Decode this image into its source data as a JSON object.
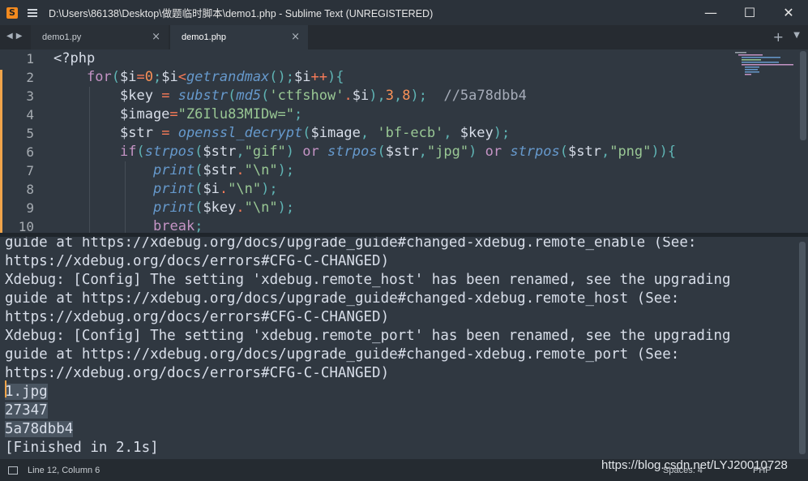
{
  "window": {
    "title": "D:\\Users\\86138\\Desktop\\做题临时脚本\\demo1.php - Sublime Text (UNREGISTERED)",
    "app_icon": "S",
    "minimize": "—",
    "maximize": "☐",
    "close": "✕"
  },
  "tabs": [
    {
      "label": "demo1.py",
      "active": false
    },
    {
      "label": "demo1.php",
      "active": true
    }
  ],
  "tab_close_icon": "×",
  "tab_add_icon": "+",
  "tab_dropdown_icon": "▼",
  "nav_arrows": {
    "back": "◀",
    "forward": "▶"
  },
  "editor": {
    "line_numbers": [
      "1",
      "2",
      "3",
      "4",
      "5",
      "6",
      "7",
      "8",
      "9",
      "10"
    ],
    "lines": [
      "<?php",
      "    for($i=0;$i<getrandmax();$i++){",
      "        $key = substr(md5('ctfshow'.$i),3,8);  //5a78dbb4",
      "        $image=\"Z6Ilu83MIDw=\";",
      "        $str = openssl_decrypt($image, 'bf-ecb', $key);",
      "        if(strpos($str,\"gif\") or strpos($str,\"jpg\") or strpos($str,\"png\")){",
      "            print($str.\"\\n\");",
      "            print($i.\"\\n\");",
      "            print($key.\"\\n\");",
      "            break;"
    ]
  },
  "output": {
    "lines": [
      "guide at https://xdebug.org/docs/upgrade_guide#changed-xdebug.remote_enable (See:",
      "https://xdebug.org/docs/errors#CFG-C-CHANGED)",
      "Xdebug: [Config] The setting 'xdebug.remote_host' has been renamed, see the upgrading",
      "guide at https://xdebug.org/docs/upgrade_guide#changed-xdebug.remote_host (See:",
      "https://xdebug.org/docs/errors#CFG-C-CHANGED)",
      "Xdebug: [Config] The setting 'xdebug.remote_port' has been renamed, see the upgrading",
      "guide at https://xdebug.org/docs/upgrade_guide#changed-xdebug.remote_port (See:",
      "https://xdebug.org/docs/errors#CFG-C-CHANGED)",
      "1.jpg",
      "27347",
      "5a78dbb4",
      "[Finished in 2.1s]"
    ]
  },
  "status": {
    "position": "Line 12, Column 6",
    "spaces": "Spaces: 4",
    "syntax": "PHP"
  },
  "watermark": "https://blog.csdn.net/LYJ20010728"
}
